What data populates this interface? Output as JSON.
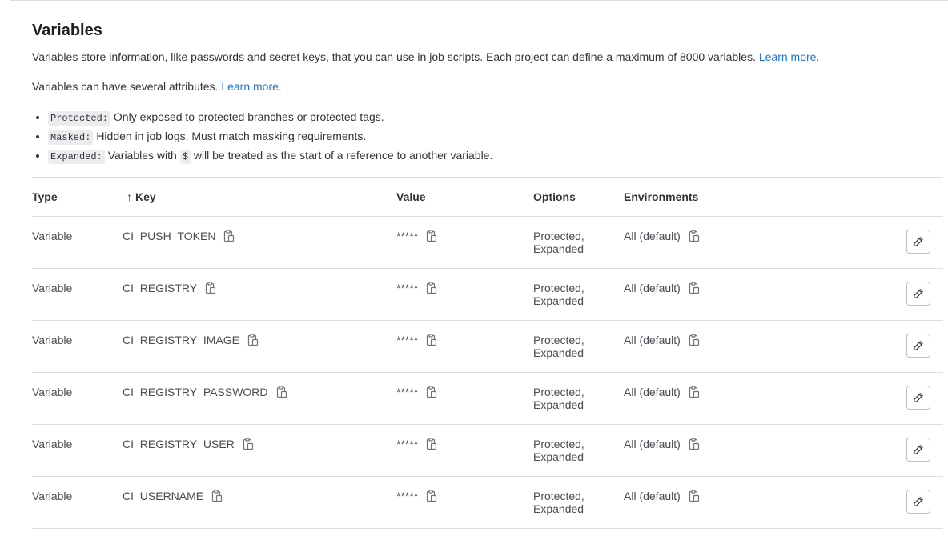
{
  "section": {
    "title": "Variables",
    "description": "Variables store information, like passwords and secret keys, that you can use in job scripts. Each project can define a maximum of 8000 variables.",
    "description_link": "Learn more.",
    "attributes_intro": "Variables can have several attributes.",
    "attributes_link": "Learn more.",
    "attributes": [
      {
        "code": "Protected:",
        "text": "Only exposed to protected branches or protected tags."
      },
      {
        "code": "Masked:",
        "text": "Hidden in job logs. Must match masking requirements."
      },
      {
        "code": "Expanded:",
        "text_before": "Variables with",
        "inline_code": "$",
        "text_after": "will be treated as the start of a reference to another variable."
      }
    ]
  },
  "table": {
    "headers": {
      "type": "Type",
      "sort_arrow": "↑",
      "key": "Key",
      "value": "Value",
      "options": "Options",
      "environments": "Environments"
    },
    "rows": [
      {
        "type": "Variable",
        "key": "CI_PUSH_TOKEN",
        "value": "*****",
        "options_line1": "Protected,",
        "options_line2": "Expanded",
        "environment": "All (default)"
      },
      {
        "type": "Variable",
        "key": "CI_REGISTRY",
        "value": "*****",
        "options_line1": "Protected,",
        "options_line2": "Expanded",
        "environment": "All (default)"
      },
      {
        "type": "Variable",
        "key": "CI_REGISTRY_IMAGE",
        "value": "*****",
        "options_line1": "Protected,",
        "options_line2": "Expanded",
        "environment": "All (default)"
      },
      {
        "type": "Variable",
        "key": "CI_REGISTRY_PASSWORD",
        "value": "*****",
        "options_line1": "Protected,",
        "options_line2": "Expanded",
        "environment": "All (default)"
      },
      {
        "type": "Variable",
        "key": "CI_REGISTRY_USER",
        "value": "*****",
        "options_line1": "Protected,",
        "options_line2": "Expanded",
        "environment": "All (default)"
      },
      {
        "type": "Variable",
        "key": "CI_USERNAME",
        "value": "*****",
        "options_line1": "Protected,",
        "options_line2": "Expanded",
        "environment": "All (default)"
      }
    ]
  },
  "icons": {
    "copy": "clipboard-icon",
    "edit": "pencil-icon"
  },
  "colors": {
    "link": "#1f75cb",
    "border": "#dcdcde",
    "code_bg": "#ececef"
  }
}
